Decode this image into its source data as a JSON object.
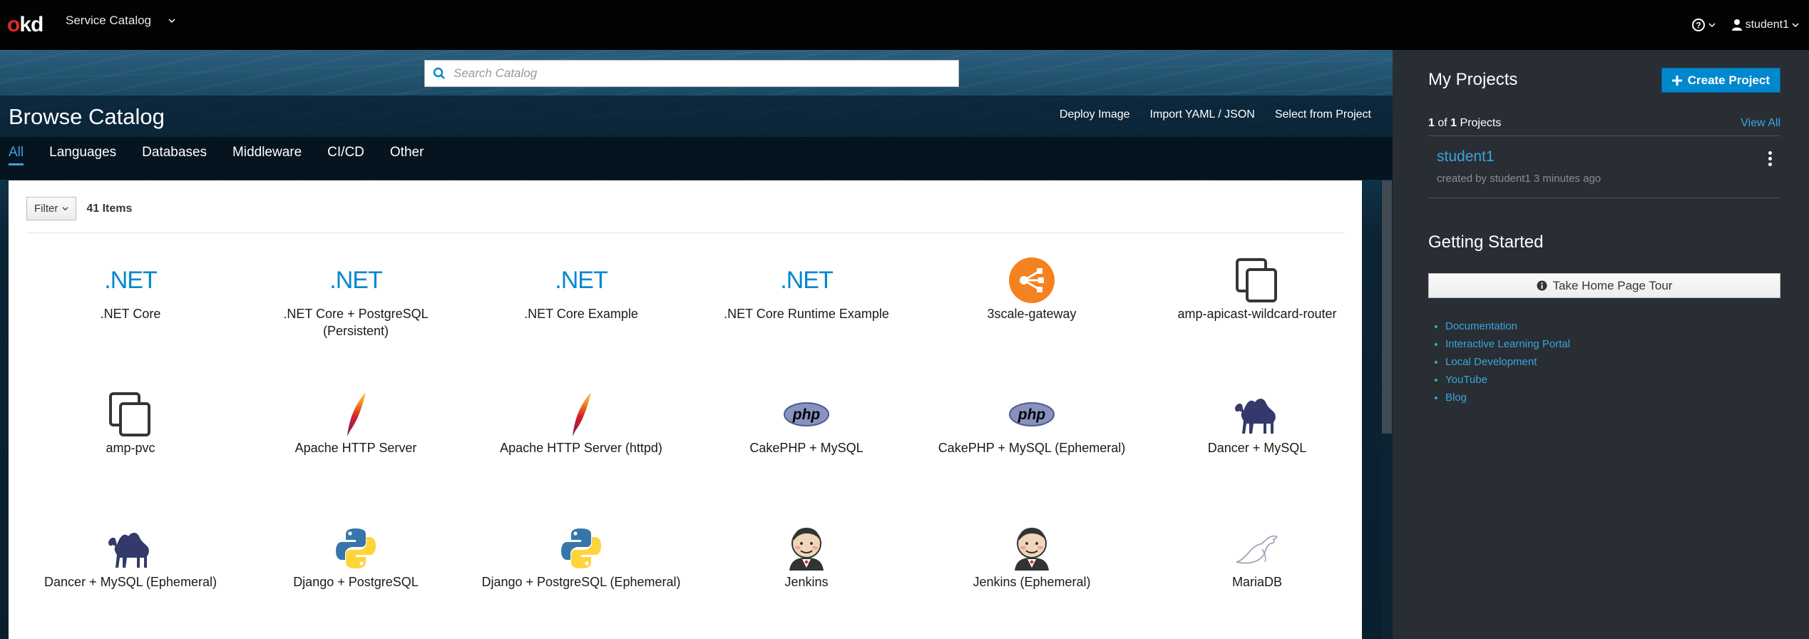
{
  "topbar": {
    "logo_prefix": "o",
    "logo_suffix": "kd",
    "context_switcher": "Service Catalog",
    "help_icon": "question-circle-icon",
    "user": "student1"
  },
  "catalog": {
    "search_placeholder": "Search Catalog",
    "title": "Browse Catalog",
    "actions": [
      "Deploy Image",
      "Import YAML / JSON",
      "Select from Project"
    ],
    "tabs": [
      "All",
      "Languages",
      "Databases",
      "Middleware",
      "CI/CD",
      "Other"
    ],
    "active_tab": "All",
    "filter_label": "Filter",
    "items_count": "41 Items",
    "items": [
      {
        "title": ".NET Core",
        "icon": "dotnet-icon",
        "icon_text": ".NET"
      },
      {
        "title": ".NET Core + PostgreSQL (Persistent)",
        "icon": "dotnet-icon",
        "icon_text": ".NET"
      },
      {
        "title": ".NET Core Example",
        "icon": "dotnet-icon",
        "icon_text": ".NET"
      },
      {
        "title": ".NET Core Runtime Example",
        "icon": "dotnet-icon",
        "icon_text": ".NET"
      },
      {
        "title": "3scale-gateway",
        "icon": "3scale-gateway-icon"
      },
      {
        "title": "amp-apicast-wildcard-router",
        "icon": "copy-icon"
      },
      {
        "title": "amp-pvc",
        "icon": "copy-icon"
      },
      {
        "title": "Apache HTTP Server",
        "icon": "apache-feather-icon"
      },
      {
        "title": "Apache HTTP Server (httpd)",
        "icon": "apache-feather-icon"
      },
      {
        "title": "CakePHP + MySQL",
        "icon": "php-icon",
        "icon_text": "php"
      },
      {
        "title": "CakePHP + MySQL (Ephemeral)",
        "icon": "php-icon",
        "icon_text": "php"
      },
      {
        "title": "Dancer + MySQL",
        "icon": "camel-icon"
      },
      {
        "title": "Dancer + MySQL (Ephemeral)",
        "icon": "camel-icon"
      },
      {
        "title": "Django + PostgreSQL",
        "icon": "python-icon"
      },
      {
        "title": "Django + PostgreSQL (Ephemeral)",
        "icon": "python-icon"
      },
      {
        "title": "Jenkins",
        "icon": "jenkins-icon"
      },
      {
        "title": "Jenkins (Ephemeral)",
        "icon": "jenkins-icon"
      },
      {
        "title": "MariaDB",
        "icon": "mariadb-seal-icon"
      }
    ]
  },
  "sidebar": {
    "my_projects_title": "My Projects",
    "create_project_label": "Create Project",
    "project_count_current": "1",
    "project_count_of": "of",
    "project_count_total": "1",
    "project_count_suffix": "Projects",
    "view_all": "View All",
    "project": {
      "name": "student1",
      "meta": "created by student1 3 minutes ago"
    },
    "getting_started_title": "Getting Started",
    "tour_button": "Take Home Page Tour",
    "links": [
      "Documentation",
      "Interactive Learning Portal",
      "Local Development",
      "YouTube",
      "Blog"
    ]
  },
  "colors": {
    "accent": "#39a5dc",
    "primary_button": "#0088ce",
    "dotnet": "#0088ce",
    "scale_orange": "#f58220",
    "php": "#8892bf",
    "camel": "#333a6b"
  }
}
